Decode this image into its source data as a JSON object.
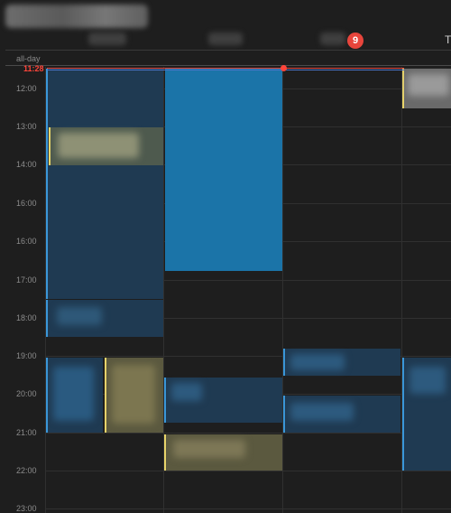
{
  "header": {
    "badge_count": "9",
    "partial_day_label": "T"
  },
  "allday_label": "all-day",
  "current_time": "11:28",
  "hours": [
    "12:00",
    "13:00",
    "14:00",
    "16:00",
    "16:00",
    "17:00",
    "18:00",
    "19:00",
    "20:00",
    "21:00",
    "22:00",
    "23:00"
  ],
  "colors": {
    "background": "#1e1e1e",
    "now_line": "#ff453a",
    "blue_event": "#1f3a52",
    "blue_accent": "#3a97d9",
    "bright_event": "#1b74a8",
    "yellow_event": "#5b593f",
    "yellow_accent": "#e8d46a"
  }
}
